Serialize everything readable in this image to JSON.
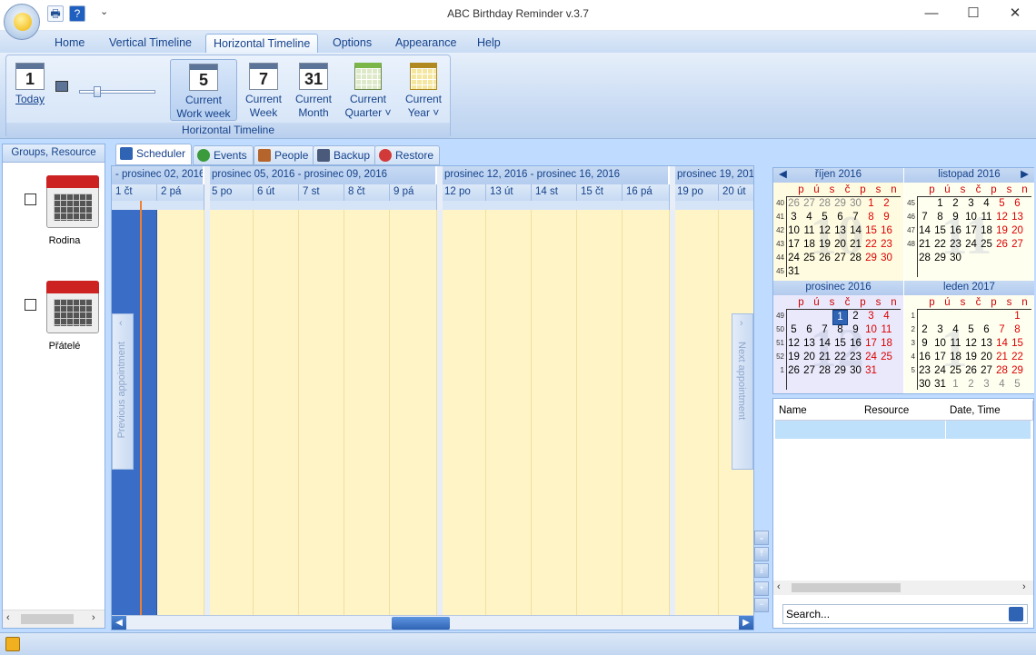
{
  "window": {
    "title": "ABC Birthday Reminder v.3.7",
    "minimize": "—",
    "maximize": "☐",
    "close": "✕"
  },
  "quick_access": {
    "print": "🖶",
    "help": "?",
    "dropdown": "⌄"
  },
  "tabs": [
    {
      "label": "Home"
    },
    {
      "label": "Vertical Timeline"
    },
    {
      "label": "Horizontal Timeline",
      "active": true
    },
    {
      "label": "Options"
    },
    {
      "label": "Appearance"
    },
    {
      "label": "Help"
    }
  ],
  "ribbon": {
    "group_label": "Horizontal Timeline",
    "today": {
      "num": "1",
      "label": "Today"
    },
    "buttons": [
      {
        "num": "5",
        "line1": "Current",
        "line2": "Work week"
      },
      {
        "num": "7",
        "line1": "Current",
        "line2": "Week"
      },
      {
        "num": "31",
        "line1": "Current",
        "line2": "Month"
      },
      {
        "line1": "Current",
        "line2": "Quarter ˅"
      },
      {
        "line1": "Current",
        "line2": "Year ˅"
      }
    ]
  },
  "groups_panel": {
    "header": "Groups, Resource",
    "resources": [
      {
        "label": "Rodina"
      },
      {
        "label": "Přátelé"
      }
    ]
  },
  "scheduler_tabs": [
    {
      "label": "Scheduler"
    },
    {
      "label": "Events"
    },
    {
      "label": "People"
    },
    {
      "label": "Backup"
    },
    {
      "label": "Restore"
    }
  ],
  "scheduler": {
    "weeks": [
      "- prosinec 02, 2016",
      "prosinec 05, 2016 - prosinec 09, 2016",
      "prosinec 12, 2016 - prosinec 16, 2016",
      "prosinec 19, 2016 -"
    ],
    "days": [
      "1 čt",
      "2 pá",
      "5 po",
      "6 út",
      "7 st",
      "8 čt",
      "9 pá",
      "12 po",
      "13 út",
      "14 st",
      "15 čt",
      "16 pá",
      "19 po",
      "20 út"
    ],
    "previous_appointment": "Previous appointment",
    "next_appointment": "Next appointment"
  },
  "calendar": {
    "dow": [
      "p",
      "ú",
      "s",
      "č",
      "p",
      "s",
      "n"
    ],
    "months": [
      {
        "title": "říjen 2016",
        "wm": "10",
        "weeks": [
          "40",
          "41",
          "42",
          "43",
          "44",
          "45"
        ],
        "rows": [
          [
            "26",
            "27",
            "28",
            "29",
            "30",
            "1",
            "2"
          ],
          [
            "3",
            "4",
            "5",
            "6",
            "7",
            "8",
            "9"
          ],
          [
            "10",
            "11",
            "12",
            "13",
            "14",
            "15",
            "16"
          ],
          [
            "17",
            "18",
            "19",
            "20",
            "21",
            "22",
            "23"
          ],
          [
            "24",
            "25",
            "26",
            "27",
            "28",
            "29",
            "30"
          ],
          [
            "31",
            "",
            "",
            "",
            "",
            "",
            ""
          ]
        ]
      },
      {
        "title": "listopad 2016",
        "wm": "11",
        "weeks": [
          "45",
          "46",
          "47",
          "48"
        ],
        "rows": [
          [
            "",
            "1",
            "2",
            "3",
            "4",
            "5",
            "6"
          ],
          [
            "7",
            "8",
            "9",
            "10",
            "11",
            "12",
            "13"
          ],
          [
            "14",
            "15",
            "16",
            "17",
            "18",
            "19",
            "20"
          ],
          [
            "21",
            "22",
            "23",
            "24",
            "25",
            "26",
            "27"
          ],
          [
            "28",
            "29",
            "30",
            "",
            "",
            "",
            ""
          ]
        ]
      },
      {
        "title": "prosinec 2016",
        "wm": "12",
        "weeks": [
          "49",
          "50",
          "51",
          "52",
          "1"
        ],
        "rows": [
          [
            "",
            "",
            "",
            "1",
            "2",
            "3",
            "4"
          ],
          [
            "5",
            "6",
            "7",
            "8",
            "9",
            "10",
            "11"
          ],
          [
            "12",
            "13",
            "14",
            "15",
            "16",
            "17",
            "18"
          ],
          [
            "19",
            "20",
            "21",
            "22",
            "23",
            "24",
            "25"
          ],
          [
            "26",
            "27",
            "28",
            "29",
            "30",
            "31",
            ""
          ]
        ]
      },
      {
        "title": "leden 2017",
        "wm": "1",
        "weeks": [
          "1",
          "2",
          "3",
          "4",
          "5"
        ],
        "rows": [
          [
            "",
            "",
            "",
            "",
            "",
            "",
            "1"
          ],
          [
            "2",
            "3",
            "4",
            "5",
            "6",
            "7",
            "8"
          ],
          [
            "9",
            "10",
            "11",
            "12",
            "13",
            "14",
            "15"
          ],
          [
            "16",
            "17",
            "18",
            "19",
            "20",
            "21",
            "22"
          ],
          [
            "23",
            "24",
            "25",
            "26",
            "27",
            "28",
            "29"
          ],
          [
            "30",
            "31",
            "1",
            "2",
            "3",
            "4",
            "5"
          ]
        ]
      }
    ]
  },
  "list": {
    "columns": [
      "Name",
      "Resource",
      "Date, Time"
    ]
  },
  "search": {
    "value": "Search..."
  }
}
